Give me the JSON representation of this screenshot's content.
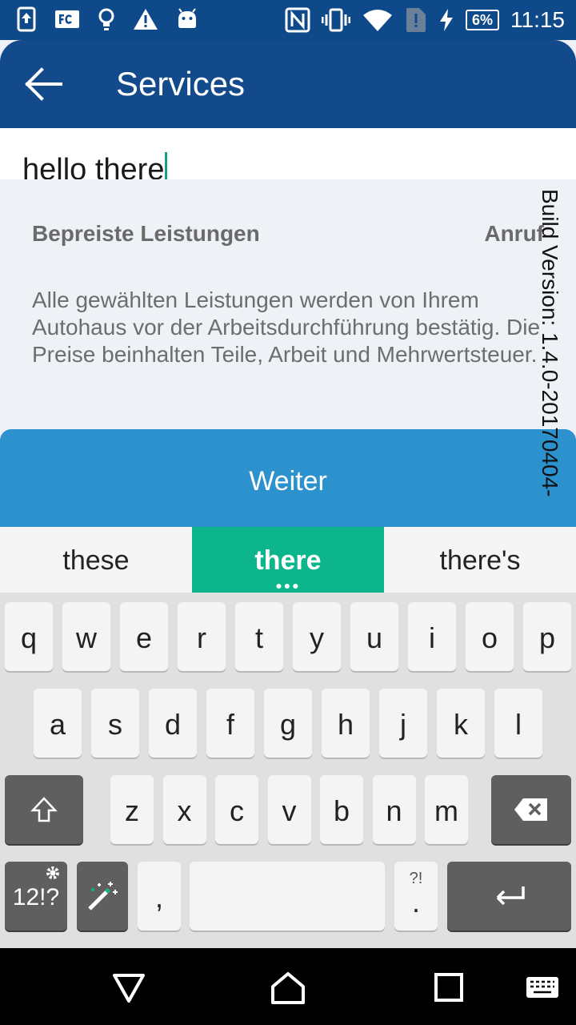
{
  "status_bar": {
    "battery": "6%",
    "time": "11:15",
    "left_icons": [
      "upload-icon",
      "fc-app-icon",
      "bulb-icon",
      "warning-icon",
      "android-icon"
    ],
    "right_icons": [
      "nfc-icon",
      "vibrate-icon",
      "wifi-icon",
      "sim-alert-icon",
      "charging-icon"
    ]
  },
  "app_bar": {
    "title": "Services",
    "back_icon": "arrow-left-icon"
  },
  "text_field": {
    "value": "hello there"
  },
  "content": {
    "section_title": "Bepreiste Leistungen",
    "call_label": "Anruf",
    "description": "Alle gewählten Leistungen werden von Ihrem Autohaus vor der Arbeitsdurchführung bestätig. Die Preise beinhalten Teile, Arbeit und Mehrwertsteuer.",
    "build_version": "Build Version: 1.4.0-20170404-"
  },
  "primary_button": {
    "label": "Weiter",
    "color": "#2c92cd"
  },
  "keyboard": {
    "suggestions": [
      "these",
      "there",
      "there's"
    ],
    "suggestion_active_color": "#0db58c",
    "rows": [
      [
        "q",
        "w",
        "e",
        "r",
        "t",
        "y",
        "u",
        "i",
        "o",
        "p"
      ],
      [
        "a",
        "s",
        "d",
        "f",
        "g",
        "h",
        "j",
        "k",
        "l"
      ],
      [
        "z",
        "x",
        "c",
        "v",
        "b",
        "n",
        "m"
      ]
    ],
    "symbols_key": "12!?",
    "comma_key": ",",
    "period_key": ".",
    "period_hint": "?!",
    "space_key": ""
  },
  "nav_bar": {
    "icons": [
      "back-triangle-icon",
      "home-icon",
      "recents-icon",
      "keyboard-icon"
    ]
  }
}
